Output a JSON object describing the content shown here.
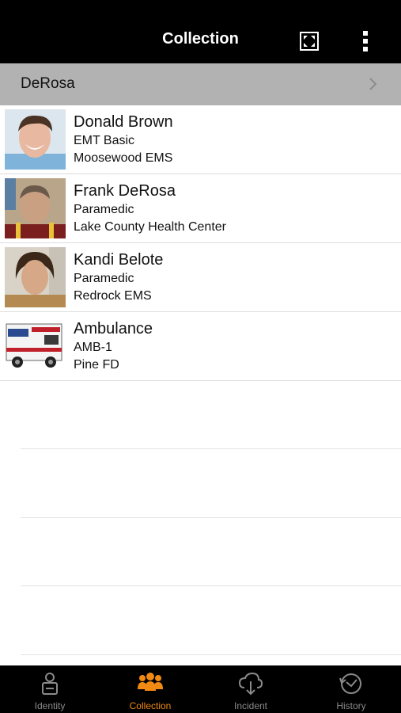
{
  "nav": {
    "title": "Collection"
  },
  "group": {
    "label": "DeRosa"
  },
  "items": [
    {
      "name": "Donald Brown",
      "role": "EMT Basic",
      "org": "Moosewood EMS"
    },
    {
      "name": "Frank DeRosa",
      "role": "Paramedic",
      "org": "Lake County Health Center"
    },
    {
      "name": "Kandi Belote",
      "role": "Paramedic",
      "org": "Redrock EMS"
    },
    {
      "name": "Ambulance",
      "role": "AMB-1",
      "org": "Pine FD"
    }
  ],
  "tabs": [
    {
      "label": "Identity",
      "icon": "id-badge-icon"
    },
    {
      "label": "Collection",
      "icon": "people-group-icon"
    },
    {
      "label": "Incident",
      "icon": "cloud-download-icon"
    },
    {
      "label": "History",
      "icon": "clock-history-icon"
    }
  ],
  "colors": {
    "accent": "#f08a12",
    "bar": "#000000",
    "header_bg": "#b2b2b2",
    "inactive": "#8a8a8a"
  }
}
